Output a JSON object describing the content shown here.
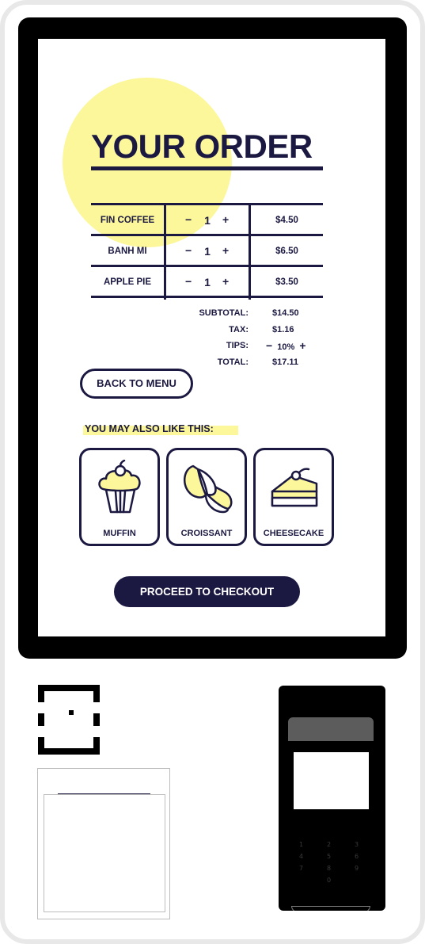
{
  "screen": {
    "title": "YOUR ORDER",
    "order_items": [
      {
        "name": "FIN COFFEE",
        "minus": "−",
        "qty": "1",
        "plus": "+",
        "price": "$4.50"
      },
      {
        "name": "BANH MI",
        "minus": "−",
        "qty": "1",
        "plus": "+",
        "price": "$6.50"
      },
      {
        "name": "APPLE PIE",
        "minus": "−",
        "qty": "1",
        "plus": "+",
        "price": "$3.50"
      }
    ],
    "totals": {
      "subtotal_label": "SUBTOTAL:",
      "subtotal_value": "$14.50",
      "tax_label": "TAX:",
      "tax_value": "$1.16",
      "tips_label": "TIPS:",
      "tips_minus": "−",
      "tips_value": "10%",
      "tips_plus": "+",
      "total_label": "TOTAL:",
      "total_value": "$17.11"
    },
    "back_button": "BACK TO MENU",
    "suggestions_label": "YOU MAY ALSO LIKE THIS:",
    "suggestions": [
      {
        "name": "MUFFIN",
        "icon": "muffin-icon"
      },
      {
        "name": "CROISSANT",
        "icon": "croissant-icon"
      },
      {
        "name": "CHEESECAKE",
        "icon": "cheesecake-icon"
      }
    ],
    "checkout_button": "PROCEED TO CHECKOUT"
  },
  "colors": {
    "navy": "#1b1941",
    "highlight_yellow": "#fcf79b",
    "bezel": "#000000",
    "kiosk_frame": "#e8e8e8"
  },
  "hardware": {
    "scanner_icon": "barcode-scanner-icon",
    "printer_icon": "receipt-printer-icon",
    "terminal_icon": "card-terminal-icon",
    "keypad": [
      "1",
      "2",
      "3",
      "4",
      "5",
      "6",
      "7",
      "8",
      "9",
      "",
      "0",
      ""
    ]
  }
}
